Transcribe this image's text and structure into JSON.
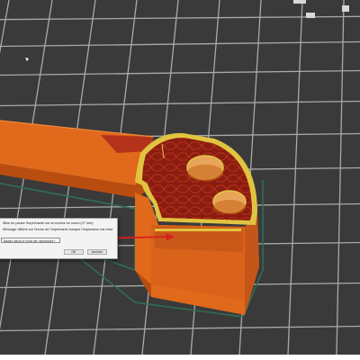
{
  "dialog": {
    "line1": "Mise en pause l'imprimante sur la couche en cours (27 mm)",
    "line2": "Message affiché sur l'écran de l'imprimante lorsque l'impression est mise en pause :",
    "line3": "Tasser dans le bord de raymonde l'imprimante",
    "ok_label": "OK",
    "cancel_label": "Annuler"
  },
  "colors": {
    "viewport_background": "#3a3a3a",
    "build_plate_grid": "#bdbdbd",
    "model_orange": "#e0691c",
    "model_orange_dark": "#b94d10",
    "infill_red": "#8a1c10",
    "top_layer_yellow": "#e0c440",
    "skirt_line": "#2f6f55",
    "annotation_arrow": "#d81e1e"
  },
  "icons": {
    "scene_object": "3d-print-model",
    "annotation": "arrow"
  }
}
